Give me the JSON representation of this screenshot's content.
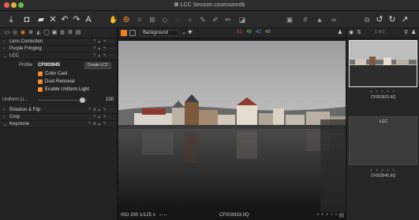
{
  "window": {
    "title": "LCC Session.cosessiondb"
  },
  "toolbar": {
    "icons": [
      "import-icon",
      "camera-icon",
      "folder-icon",
      "delete-icon",
      "undo-icon",
      "redo-icon",
      "text-icon",
      "pan-icon",
      "white-balance-icon",
      "crop-icon",
      "straighten-icon",
      "keystone-icon",
      "spot-icon",
      "circle-icon",
      "brush-icon",
      "eraser-icon",
      "gradient-icon",
      "grid-icon",
      "exposure-warning-icon",
      "overlay-icon",
      "rotate-left-icon",
      "rotate-right-icon",
      "reset-icon"
    ]
  },
  "left_panel": {
    "sections": {
      "lens_correction": "Lens Correction",
      "purple_fringing": "Purple Fringing",
      "lcc": "LCC",
      "rotation_flip": "Rotation & Flip",
      "crop": "Crop",
      "keystone": "Keystone"
    },
    "profile_label": "Profile",
    "profile_value": "CF003945",
    "create_lcc_label": "Create LCC",
    "options": [
      "Color Cast",
      "Dust Removal",
      "Enable Uniform Light"
    ],
    "uniform_light_label": "Uniform Li...",
    "uniform_light_value": "100"
  },
  "viewer": {
    "background_label": "Background",
    "rgb": [
      "51",
      "49",
      "42",
      "49"
    ],
    "rgb_colors": [
      "#e25454",
      "#6fc45c",
      "#5a8fe0",
      "#aaaaaa"
    ],
    "iso": "ISO 200",
    "shutter": "1/125 s",
    "dashes": "--  --",
    "filename": "CF003933.IIQ"
  },
  "right_panel": {
    "page_label": "1 of 2",
    "thumbnails": [
      {
        "caption": "CF003933.IIQ",
        "badge": ""
      },
      {
        "caption": "CF003945.IIQ",
        "badge": "LCC"
      }
    ],
    "dots": "• • • • •"
  },
  "colors": {
    "accent": "#f0821d",
    "panel": "#232323"
  }
}
